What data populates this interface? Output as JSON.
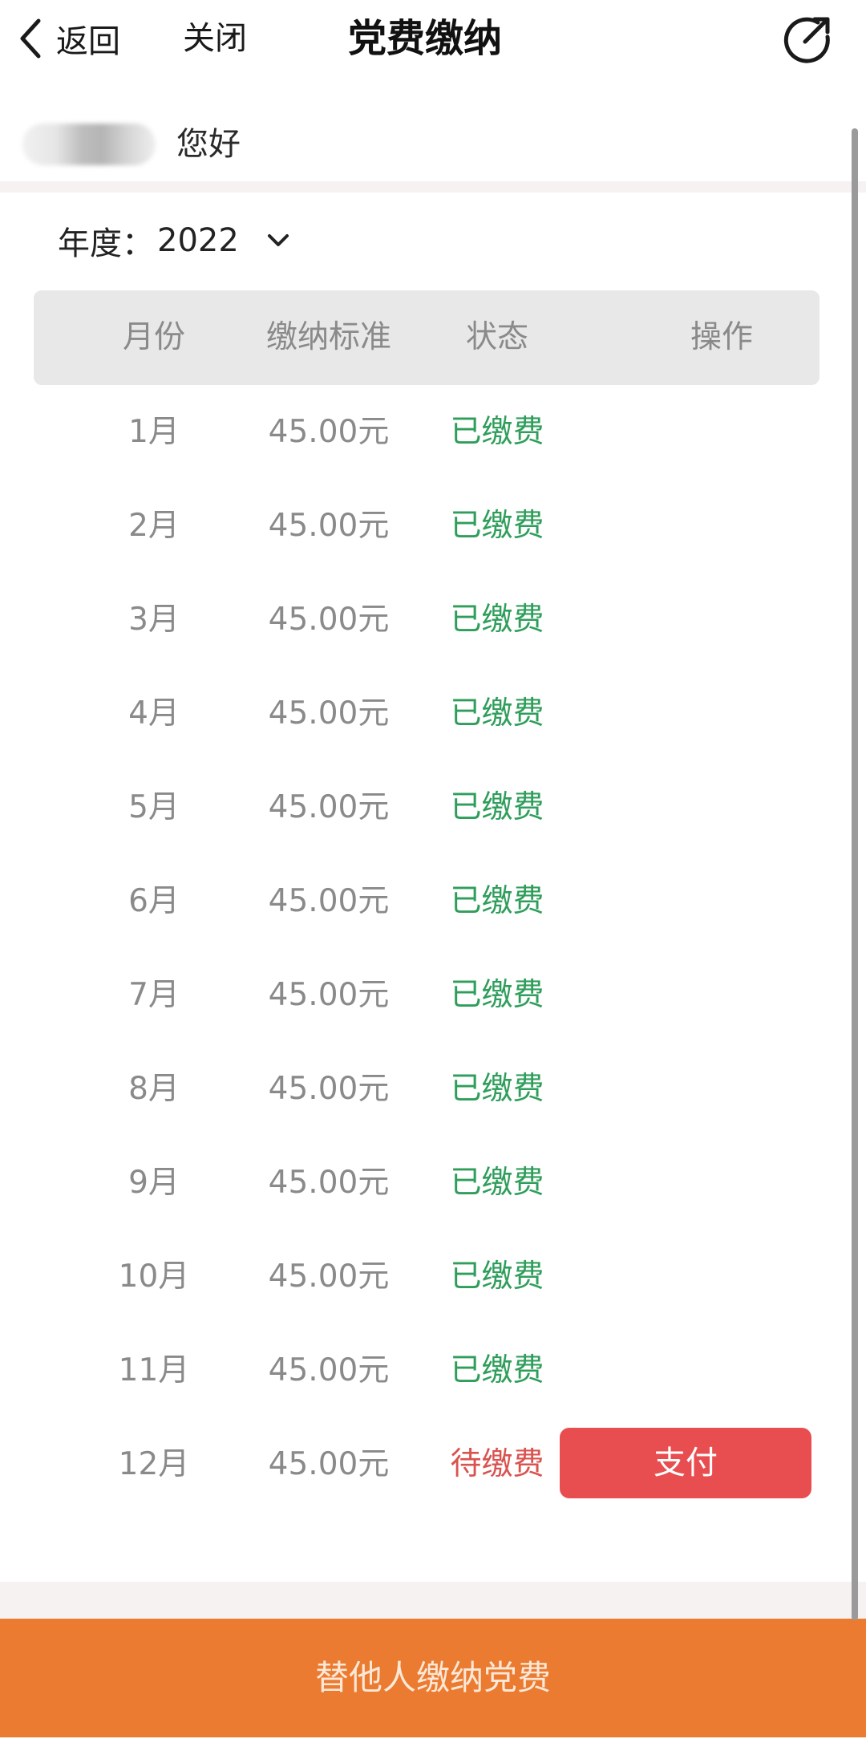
{
  "nav": {
    "back_label": "返回",
    "close_label": "关闭",
    "title": "党费缴纳"
  },
  "greeting": {
    "text": "您好"
  },
  "year_filter": {
    "label": "年度：",
    "value": "2022"
  },
  "table": {
    "headers": {
      "month": "月份",
      "standard": "缴纳标准",
      "status": "状态",
      "operation": "操作"
    },
    "rows": [
      {
        "month": "1月",
        "amount": "45.00元",
        "status": "已缴费",
        "status_type": "paid"
      },
      {
        "month": "2月",
        "amount": "45.00元",
        "status": "已缴费",
        "status_type": "paid"
      },
      {
        "month": "3月",
        "amount": "45.00元",
        "status": "已缴费",
        "status_type": "paid"
      },
      {
        "month": "4月",
        "amount": "45.00元",
        "status": "已缴费",
        "status_type": "paid"
      },
      {
        "month": "5月",
        "amount": "45.00元",
        "status": "已缴费",
        "status_type": "paid"
      },
      {
        "month": "6月",
        "amount": "45.00元",
        "status": "已缴费",
        "status_type": "paid"
      },
      {
        "month": "7月",
        "amount": "45.00元",
        "status": "已缴费",
        "status_type": "paid"
      },
      {
        "month": "8月",
        "amount": "45.00元",
        "status": "已缴费",
        "status_type": "paid"
      },
      {
        "month": "9月",
        "amount": "45.00元",
        "status": "已缴费",
        "status_type": "paid"
      },
      {
        "month": "10月",
        "amount": "45.00元",
        "status": "已缴费",
        "status_type": "paid"
      },
      {
        "month": "11月",
        "amount": "45.00元",
        "status": "已缴费",
        "status_type": "paid"
      },
      {
        "month": "12月",
        "amount": "45.00元",
        "status": "待缴费",
        "status_type": "pending"
      }
    ],
    "pay_button_label": "支付"
  },
  "bottom_action": {
    "label": "替他人缴纳党费"
  },
  "colors": {
    "paid": "#2f9e5b",
    "pending": "#d9534f",
    "pay_button": "#e84e50",
    "bottom_bar": "#ea7b30"
  },
  "icons": {
    "back": "chevron-left-icon",
    "share": "share-arrow-icon",
    "year_dropdown": "chevron-down-icon"
  }
}
